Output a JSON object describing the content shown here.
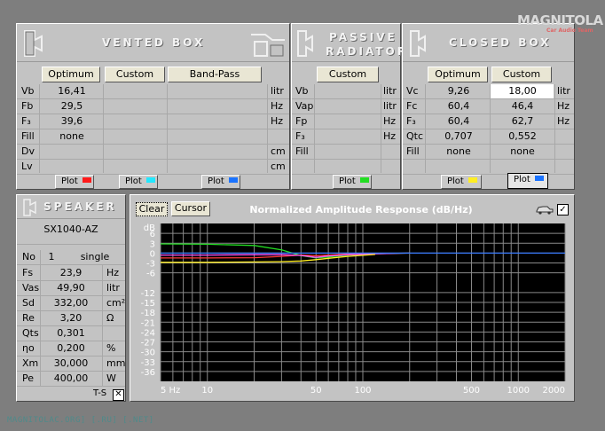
{
  "watermark": "MAGNITOLAC.ORG] [.RU] [.NET]",
  "logo": {
    "text": "MAGNITOLA",
    "sub": "Car Audio Team"
  },
  "vented": {
    "title": "VENTED BOX",
    "columns": [
      "Optimum",
      "Custom",
      "Band-Pass"
    ],
    "rows": [
      {
        "label": "Vb",
        "values": [
          "16,41",
          "",
          ""
        ],
        "unit": "litr"
      },
      {
        "label": "Fb",
        "values": [
          "29,5",
          "",
          ""
        ],
        "unit": "Hz"
      },
      {
        "label": "F₃",
        "values": [
          "39,6",
          "",
          ""
        ],
        "unit": "Hz"
      },
      {
        "label": "Fill",
        "values": [
          "none",
          "",
          ""
        ],
        "unit": ""
      },
      {
        "label": "Dv",
        "values": [
          "",
          "",
          ""
        ],
        "unit": "cm"
      },
      {
        "label": "Lv",
        "values": [
          "",
          "",
          ""
        ],
        "unit": "cm"
      }
    ],
    "plot": "Plot",
    "plot_colors": [
      "#ff1a1a",
      "#22e8ff",
      "#1a73ff"
    ]
  },
  "passive": {
    "title1": "PASSIVE",
    "title2": "RADIATOR",
    "column": "Custom",
    "rows": [
      {
        "label": "Vb",
        "value": "",
        "unit": "litr"
      },
      {
        "label": "Vap",
        "value": "",
        "unit": "litr"
      },
      {
        "label": "Fp",
        "value": "",
        "unit": "Hz"
      },
      {
        "label": "F₃",
        "value": "",
        "unit": "Hz"
      },
      {
        "label": "Fill",
        "value": "",
        "unit": ""
      }
    ],
    "plot": "Plot",
    "plot_color": "#22dd22"
  },
  "closed": {
    "title": "CLOSED BOX",
    "columns": [
      "Optimum",
      "Custom"
    ],
    "rows": [
      {
        "label": "Vc",
        "values": [
          "9,26",
          "18,00"
        ],
        "unit": "litr"
      },
      {
        "label": "Fc",
        "values": [
          "60,4",
          "46,4"
        ],
        "unit": "Hz"
      },
      {
        "label": "F₃",
        "values": [
          "60,4",
          "62,7"
        ],
        "unit": "Hz"
      },
      {
        "label": "Qtc",
        "values": [
          "0,707",
          "0,552"
        ],
        "unit": ""
      },
      {
        "label": "Fill",
        "values": [
          "none",
          "none"
        ],
        "unit": ""
      }
    ],
    "plot": "Plot",
    "plot_colors": [
      "#ffee22",
      "#1a73ff"
    ]
  },
  "speaker": {
    "title": "SPEAKER",
    "model": "SX1040-AZ",
    "no_label": "No",
    "no_value": "1",
    "mode": "single",
    "params": [
      {
        "label": "Fs",
        "value": "23,9",
        "unit": "Hz"
      },
      {
        "label": "Vas",
        "value": "49,90",
        "unit": "litr"
      },
      {
        "label": "Sd",
        "value": "332,00",
        "unit": "cm²"
      },
      {
        "label": "Re",
        "value": "3,20",
        "unit": "Ω"
      },
      {
        "label": "Qts",
        "value": "0,301",
        "unit": ""
      },
      {
        "label": "ηo",
        "value": "0,200",
        "unit": "%"
      },
      {
        "label": "Xm",
        "value": "30,000",
        "unit": "mm"
      },
      {
        "label": "Pe",
        "value": "400,00",
        "unit": "W"
      }
    ],
    "ts_label": "T-S"
  },
  "graph": {
    "clear": "Clear",
    "cursor": "Cursor",
    "title": "Normalized Amplitude Response (dB/Hz)",
    "checkbox": "✓"
  },
  "chart_data": {
    "type": "line",
    "title": "Normalized Amplitude Response (dB/Hz)",
    "ylabel": "dB",
    "xscale": "log",
    "xlim": [
      5,
      2000
    ],
    "ylim": [
      -39,
      9
    ],
    "yticks": [
      6,
      3,
      0,
      -3,
      -6,
      -12,
      -15,
      -18,
      -21,
      -24,
      -27,
      -30,
      -33,
      -36
    ],
    "xtick_labels": [
      {
        "v": 5,
        "t": "5 Hz"
      },
      {
        "v": 10,
        "t": "10"
      },
      {
        "v": 50,
        "t": "50"
      },
      {
        "v": 100,
        "t": "100"
      },
      {
        "v": 500,
        "t": "500"
      },
      {
        "v": 1000,
        "t": "1000"
      },
      {
        "v": 2000,
        "t": "2000"
      }
    ],
    "background": "#000000",
    "grid": true,
    "series": [
      {
        "color": "#22dd22",
        "x": [
          5,
          10,
          20,
          30,
          40,
          50,
          60,
          80,
          120,
          200
        ],
        "y": [
          2.8,
          2.7,
          2.3,
          1.0,
          -0.8,
          -1.5,
          -1.2,
          -0.6,
          -0.2,
          0
        ]
      },
      {
        "color": "#ff3b3b",
        "x": [
          5,
          10,
          20,
          30,
          40,
          50,
          60,
          80,
          120
        ],
        "y": [
          -1.5,
          -1.5,
          -1.4,
          -1.0,
          -0.6,
          -0.8,
          -0.6,
          -0.3,
          -0.1
        ]
      },
      {
        "color": "#ff55ff",
        "x": [
          5,
          10,
          20,
          30,
          40,
          50,
          60,
          80,
          120,
          200
        ],
        "y": [
          -0.6,
          -0.6,
          -0.5,
          -0.5,
          -0.7,
          -1.3,
          -0.9,
          -0.5,
          -0.2,
          0
        ]
      },
      {
        "color": "#ffee22",
        "x": [
          5,
          10,
          20,
          30,
          40,
          50,
          60,
          80,
          120
        ],
        "y": [
          -2.8,
          -2.8,
          -2.7,
          -2.6,
          -2.4,
          -2.0,
          -1.6,
          -1.0,
          -0.4
        ]
      },
      {
        "color": "#3a7bff",
        "x": [
          5,
          10,
          30,
          60,
          100,
          200,
          500,
          2000
        ],
        "y": [
          0,
          0,
          0,
          0,
          0,
          0,
          0,
          0
        ]
      }
    ]
  }
}
